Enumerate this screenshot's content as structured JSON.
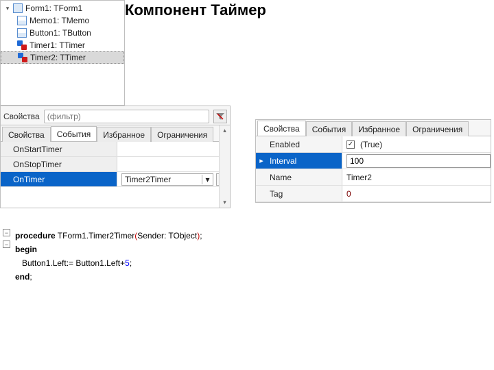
{
  "title": "Компонент Таймер",
  "tree": {
    "root": {
      "label": "Form1: TForm1"
    },
    "items": [
      {
        "label": "Memo1: TMemo",
        "kind": "comp"
      },
      {
        "label": "Button1: TButton",
        "kind": "comp"
      },
      {
        "label": "Timer1: TTimer",
        "kind": "timer"
      },
      {
        "label": "Timer2: TTimer",
        "kind": "timer",
        "selected": true
      }
    ]
  },
  "leftPanel": {
    "filterLabel": "Свойства",
    "filterPlaceholder": "(фильтр)",
    "tabs": [
      "Свойства",
      "События",
      "Избранное",
      "Ограничения"
    ],
    "activeTab": 1,
    "rows": [
      {
        "name": "OnStartTimer",
        "value": ""
      },
      {
        "name": "OnStopTimer",
        "value": ""
      },
      {
        "name": "OnTimer",
        "value": "Timer2Timer",
        "selected": true,
        "editor": "combo"
      }
    ],
    "dots": "…"
  },
  "rightPanel": {
    "tabs": [
      "Свойства",
      "События",
      "Избранное",
      "Ограничения"
    ],
    "activeTab": 0,
    "rows": [
      {
        "name": "Enabled",
        "value": "(True)",
        "check": true
      },
      {
        "name": "Interval",
        "value": "100",
        "selected": true,
        "editor": "input"
      },
      {
        "name": "Name",
        "value": "Timer2"
      },
      {
        "name": "Tag",
        "value": "0",
        "bold": true
      }
    ]
  },
  "code": {
    "l1_kw1": "procedure",
    "l1_rest": " TForm1.Timer2Timer(Sender: TObject);",
    "l2": "begin",
    "l3": "   Button1.Left:= Button1.Left+5;",
    "l4": "end",
    "semi": ";"
  }
}
